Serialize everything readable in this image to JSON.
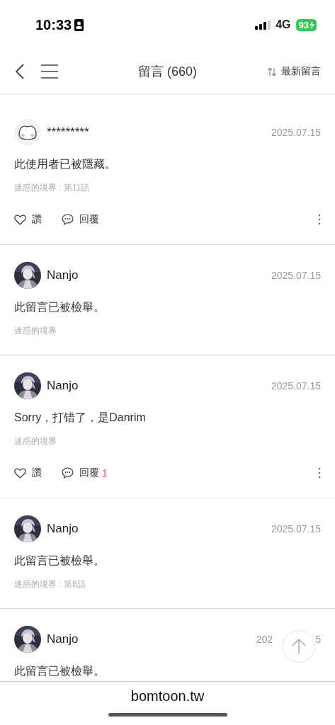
{
  "status_bar": {
    "time": "10:33",
    "network": "4G",
    "battery": "93"
  },
  "header": {
    "title": "留言 (660)",
    "sort": "最新留言"
  },
  "comments": [
    {
      "avatar": {
        "kind": "sticker"
      },
      "name": "*********",
      "date": "2025.07.15",
      "body": "此使用者已被隱藏。",
      "source": "迷惑的境界 : 第11話",
      "actions": {
        "like": "讚",
        "reply": "回覆"
      }
    },
    {
      "name": "Nanjo",
      "date": "2025.07.15",
      "body": "此留言已被檢舉。",
      "source": "迷惑的境界"
    },
    {
      "name": "Nanjo",
      "date": "2025.07.15",
      "body": "Sorry，打错了，是Danrim",
      "source": "迷惑的境界",
      "actions": {
        "like": "讚",
        "reply": "回覆",
        "reply_count": "1"
      }
    },
    {
      "name": "Nanjo",
      "date": "2025.07.15",
      "body": "此留言已被檢舉。",
      "source": "迷惑的境界 : 第8話"
    },
    {
      "name": "Nanjo",
      "date_parts": [
        "202",
        "5"
      ],
      "body": "此留言已被檢舉。"
    }
  ],
  "browser_bar": {
    "url": "bomtoon.tw"
  }
}
